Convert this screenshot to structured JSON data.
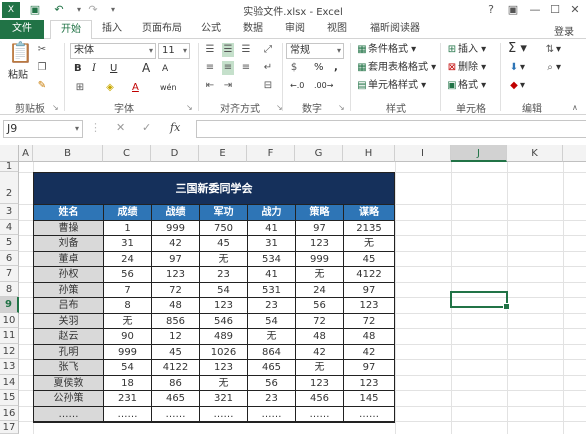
{
  "window": {
    "title": "实验文件.xlsx - Excel",
    "quick_access": [
      "save-icon",
      "undo-icon",
      "redo-icon"
    ],
    "controls": [
      "?",
      "▣",
      "—",
      "☐",
      "✕"
    ]
  },
  "tabs": [
    "文件",
    "开始",
    "插入",
    "页面布局",
    "公式",
    "数据",
    "审阅",
    "视图",
    "福昕阅读器"
  ],
  "login": "登录",
  "ribbon": {
    "clipboard": {
      "paste": "粘贴",
      "label": "剪贴板"
    },
    "font": {
      "name": "宋体",
      "size": "11",
      "label": "字体",
      "bold": "B",
      "italic": "I",
      "underline": "U",
      "grow": "A",
      "shrink": "A",
      "color": "A",
      "wen": "wén"
    },
    "alignment": {
      "label": "对齐方式"
    },
    "number": {
      "format": "常规",
      "percent": "%",
      "comma": ",",
      "label": "数字"
    },
    "styles": {
      "conditional": "条件格式",
      "table": "套用表格格式",
      "cell": "单元格样式",
      "label": "样式"
    },
    "cells": {
      "insert": "插入",
      "delete": "删除",
      "format": "格式",
      "label": "单元格"
    },
    "editing": {
      "label": "编辑"
    }
  },
  "formula_bar": {
    "name_box": "J9",
    "cancel": "✕",
    "enter": "✓",
    "fx": "fx",
    "value": ""
  },
  "columns": [
    "A",
    "B",
    "C",
    "D",
    "E",
    "F",
    "G",
    "H",
    "I",
    "J",
    "K"
  ],
  "rows": [
    "1",
    "2",
    "3",
    "4",
    "5",
    "6",
    "7",
    "8",
    "9",
    "10",
    "11",
    "12",
    "13",
    "14",
    "15",
    "16",
    "17"
  ],
  "selected": {
    "column": "J",
    "row": "9"
  },
  "table": {
    "title": "三国新委同学会",
    "headers": [
      "姓名",
      "成绩",
      "战绩",
      "军功",
      "战力",
      "策略",
      "谋略"
    ],
    "rows": [
      [
        "曹操",
        "1",
        "999",
        "750",
        "41",
        "97",
        "2135"
      ],
      [
        "刘备",
        "31",
        "42",
        "45",
        "31",
        "123",
        "无"
      ],
      [
        "董卓",
        "24",
        "97",
        "无",
        "534",
        "999",
        "45"
      ],
      [
        "孙权",
        "56",
        "123",
        "23",
        "41",
        "无",
        "4122"
      ],
      [
        "孙策",
        "7",
        "72",
        "54",
        "531",
        "24",
        "97"
      ],
      [
        "吕布",
        "8",
        "48",
        "123",
        "23",
        "56",
        "123"
      ],
      [
        "关羽",
        "无",
        "856",
        "546",
        "54",
        "72",
        "72"
      ],
      [
        "赵云",
        "90",
        "12",
        "489",
        "无",
        "48",
        "48"
      ],
      [
        "孔明",
        "999",
        "45",
        "1026",
        "864",
        "42",
        "42"
      ],
      [
        "张飞",
        "54",
        "4122",
        "123",
        "465",
        "无",
        "97"
      ],
      [
        "夏侯敦",
        "18",
        "86",
        "无",
        "56",
        "123",
        "123"
      ],
      [
        "公孙策",
        "231",
        "465",
        "321",
        "23",
        "456",
        "145"
      ],
      [
        "……",
        "……",
        "……",
        "……",
        "……",
        "……",
        "……"
      ]
    ]
  },
  "colors": {
    "excel_green": "#217346",
    "title_bg": "#15305b",
    "header_bg": "#2e75b6",
    "name_bg": "#d9d9d9"
  }
}
